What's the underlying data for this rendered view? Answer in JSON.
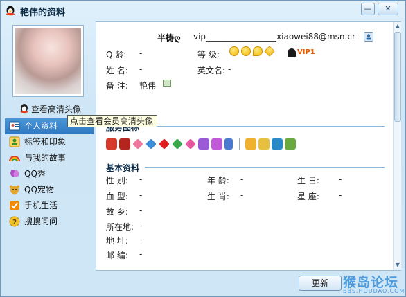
{
  "window": {
    "title": "艳伟的资料",
    "minimize_glyph": "—",
    "close_glyph": "✕"
  },
  "sidebar": {
    "hd_link": "查看高清头像",
    "tooltip": "点击查看会员高清头像",
    "items": [
      {
        "label": "个人资料",
        "icon": "profile-card-icon",
        "active": true,
        "color": "#3b82c4"
      },
      {
        "label": "标签和印象",
        "icon": "tag-person-icon",
        "active": false,
        "color": "#e8a000"
      },
      {
        "label": "与我的故事",
        "icon": "rainbow-icon",
        "active": false,
        "color": "#e04a3c"
      },
      {
        "label": "QQ秀",
        "icon": "balloon-icon",
        "active": false,
        "color": "#b04ac8"
      },
      {
        "label": "QQ宠物",
        "icon": "pet-icon",
        "active": false,
        "color": "#d69a1e"
      },
      {
        "label": "手机生活",
        "icon": "check-badge-icon",
        "active": false,
        "color": "#f08a00"
      },
      {
        "label": "搜搜问问",
        "icon": "question-icon",
        "active": false,
        "color": "#e0b000"
      }
    ]
  },
  "profile": {
    "nickname": "半梼ღ",
    "signature": "vip_________________xiaowei88@msn.cr",
    "fields": {
      "qq_label": "Q    龄:",
      "qq_value": "-",
      "level_label": "等    级:",
      "name_label": "姓    名:",
      "name_value": "-",
      "english_name_label": "英文名:",
      "english_name_value": "-",
      "remark_label": "备    注:",
      "remark_value": "艳伟"
    },
    "vip_badge": "VIP1",
    "level_icons": [
      "sun-icon",
      "sun-icon",
      "moon-icon",
      "star-icon"
    ]
  },
  "services": {
    "title": "服务图标"
  },
  "basic": {
    "title": "基本资料",
    "rows": [
      [
        {
          "label": "性    别:",
          "value": "-"
        },
        {
          "label": "年    龄:",
          "value": "-"
        },
        {
          "label": "生      日:",
          "value": "-"
        }
      ],
      [
        {
          "label": "血    型:",
          "value": "-"
        },
        {
          "label": "生    肖:",
          "value": "-"
        },
        {
          "label": "星      座:",
          "value": "-"
        }
      ],
      [
        {
          "label": "故    乡:",
          "value": "-"
        }
      ],
      [
        {
          "label": "所在地:",
          "value": "-"
        }
      ],
      [
        {
          "label": "地    址:",
          "value": "-"
        }
      ],
      [
        {
          "label": "邮    编:",
          "value": "-"
        }
      ]
    ]
  },
  "footer": {
    "refresh_label": "更新",
    "watermark": "猴岛论坛",
    "watermark_url": "BBS.HOUDAO.COM"
  },
  "colors": {
    "accent": "#2e78c2",
    "section_rule": "#8fb9dc",
    "vip": "#e85b00"
  }
}
